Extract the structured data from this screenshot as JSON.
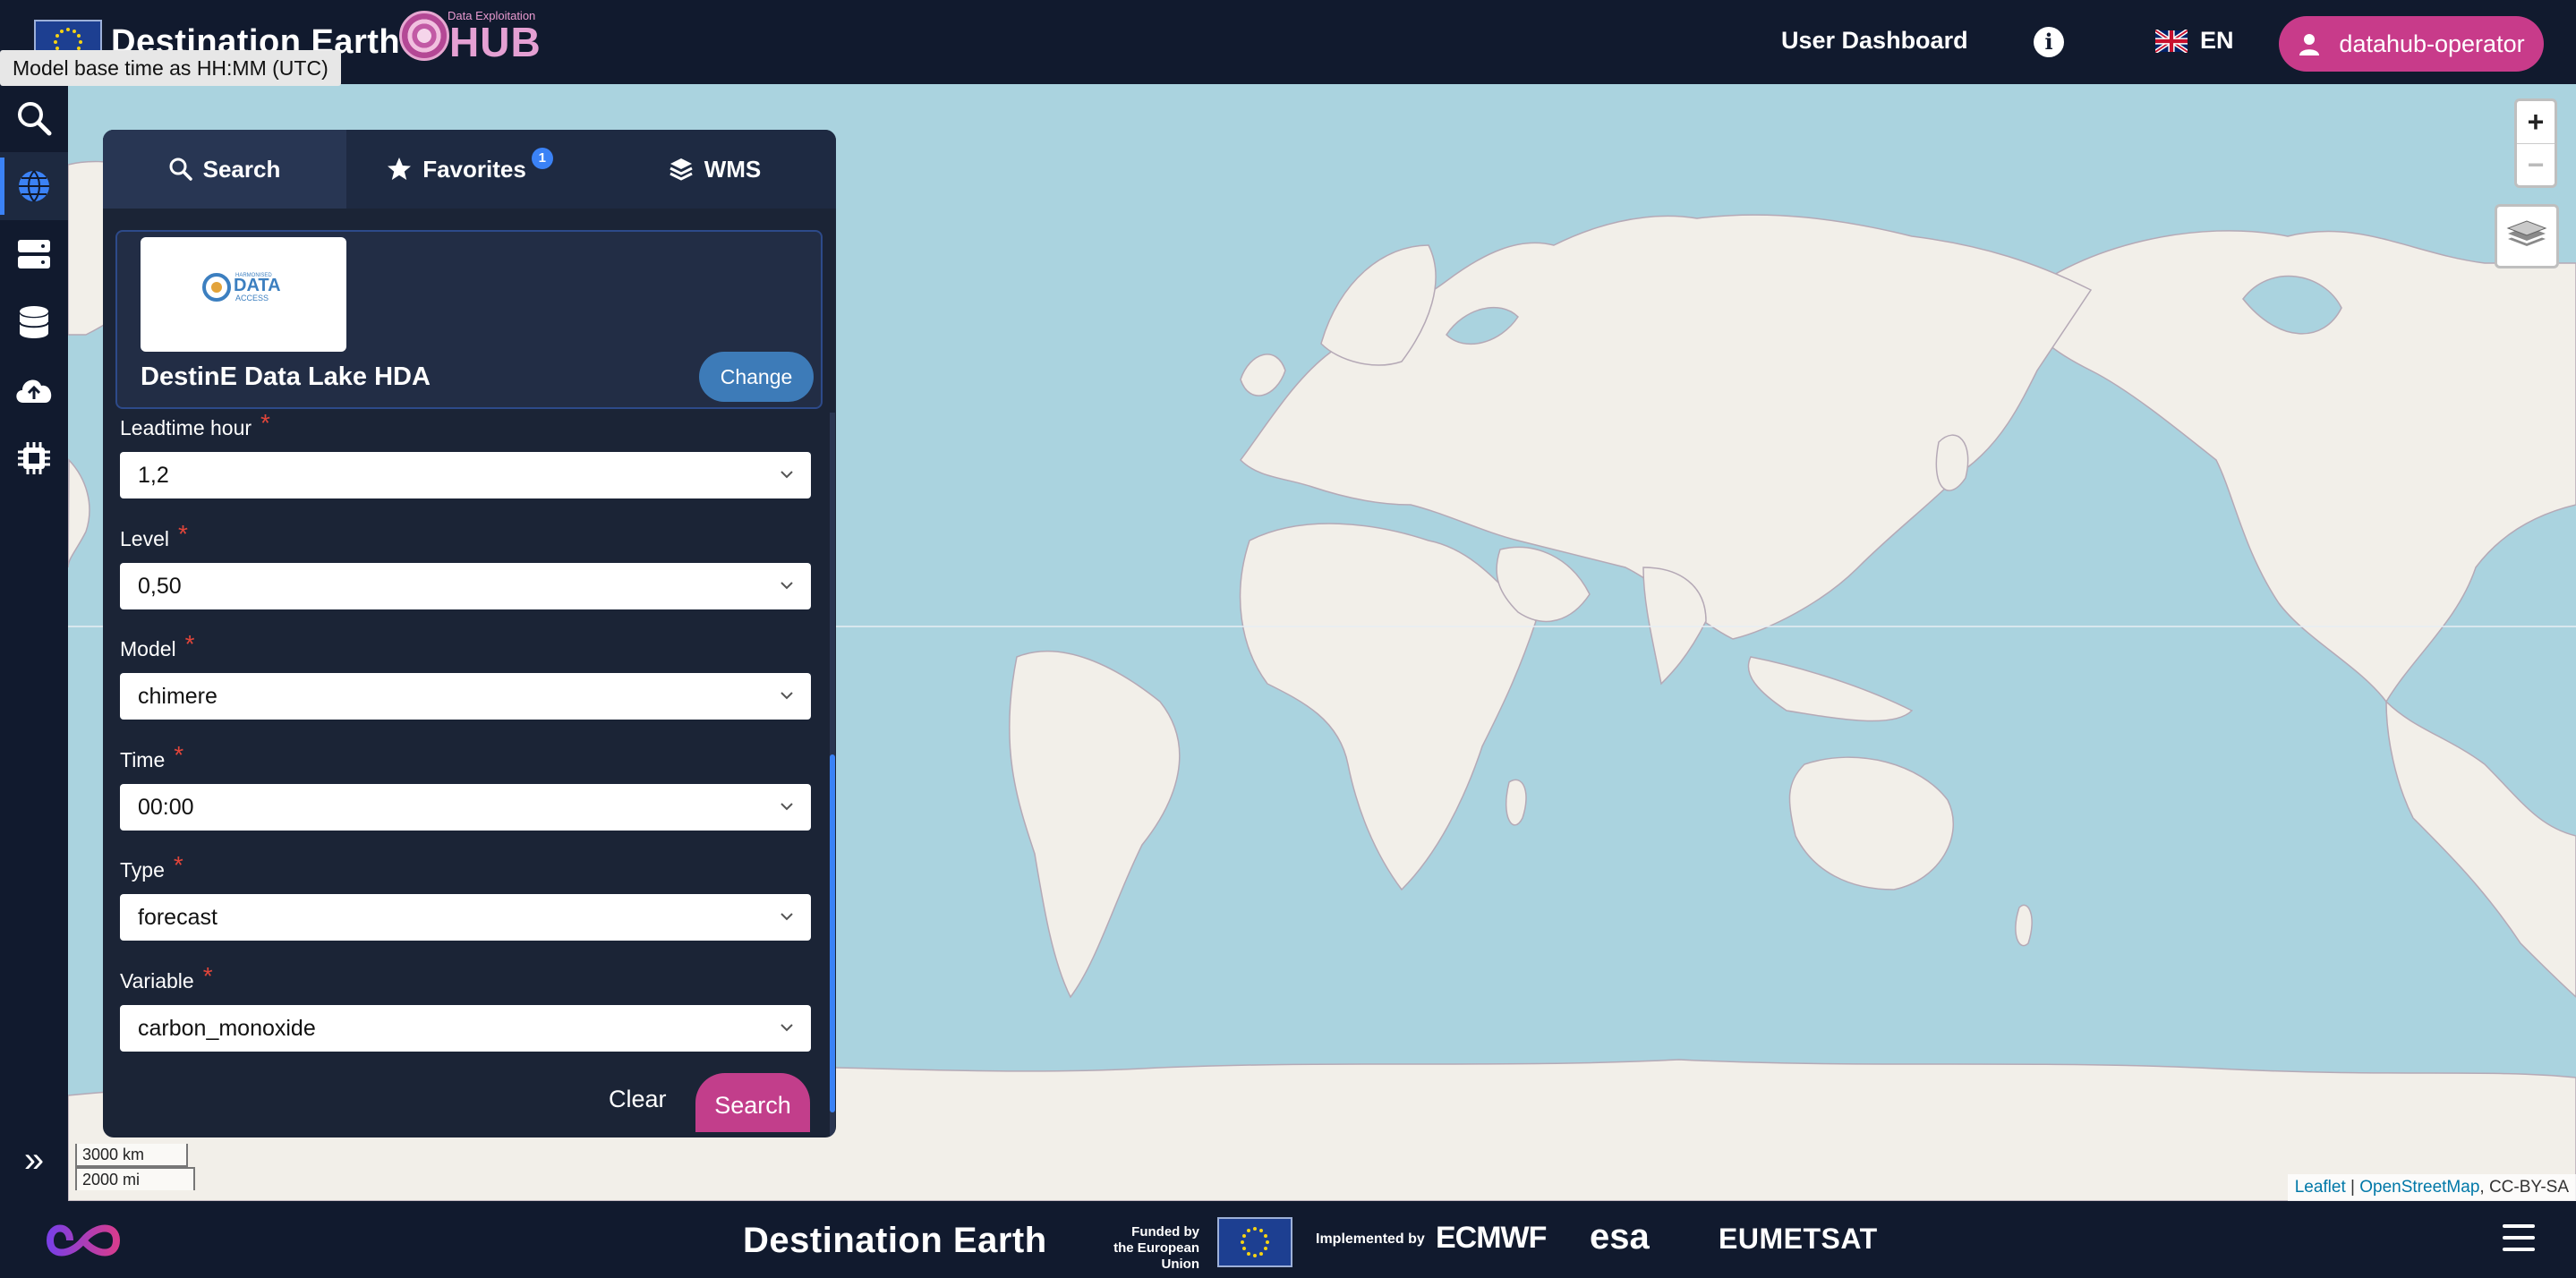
{
  "header": {
    "brand_title": "Destination Earth",
    "hub_small": "Data Exploitation",
    "hub_big": "HUB",
    "tooltip": "Model base time as HH:MM (UTC)",
    "dashboard_label": "User Dashboard",
    "info_icon": "info-icon",
    "language": "EN",
    "user": "datahub-operator"
  },
  "rail": {
    "items": [
      "search-icon",
      "globe-icon",
      "server-icon",
      "database-icon",
      "cloud-upload-icon",
      "chip-icon"
    ],
    "active": "globe-icon"
  },
  "panel": {
    "tabs": [
      {
        "label": "Search",
        "icon": "search-icon",
        "active": true
      },
      {
        "label": "Favorites",
        "icon": "star-icon",
        "badge": "1"
      },
      {
        "label": "WMS",
        "icon": "layers-icon"
      }
    ],
    "provider": {
      "logo_text_top": "HARMONISED",
      "logo_text_main": "DATA",
      "logo_text_bottom": "ACCESS",
      "name": "DestinE Data Lake HDA",
      "change_label": "Change"
    },
    "fields": [
      {
        "label": "Leadtime hour",
        "value": "1,2",
        "required": "*"
      },
      {
        "label": "Level",
        "value": "0,50",
        "required": "*"
      },
      {
        "label": "Model",
        "value": "chimere",
        "required": "*"
      },
      {
        "label": "Time",
        "value": "00:00",
        "required": "*"
      },
      {
        "label": "Type",
        "value": "forecast",
        "required": "*"
      },
      {
        "label": "Variable",
        "value": "carbon_monoxide",
        "required": "*"
      }
    ],
    "clear_label": "Clear",
    "search_label": "Search"
  },
  "map": {
    "zoom_in": "+",
    "zoom_out": "−",
    "scale_km": "3000 km",
    "scale_mi": "2000 mi",
    "attribution_leaflet": "Leaflet",
    "attribution_sep": " | ",
    "attribution_osm": "OpenStreetMap",
    "attribution_license": ", CC-BY-SA",
    "water_color": "#aad3df",
    "land_color": "#f2efe9"
  },
  "footer": {
    "title": "Destination Earth",
    "funded_line1": "Funded by",
    "funded_line2": "the European Union",
    "implemented": "Implemented by",
    "ecmwf": "ECMWF",
    "esa": "esa",
    "eumetsat": "EUMETSAT"
  },
  "colors": {
    "accent_pink": "#c83b8a",
    "accent_blue": "#3b82f6",
    "bar_bg": "#111a2e",
    "panel_bg": "#1b2436"
  }
}
